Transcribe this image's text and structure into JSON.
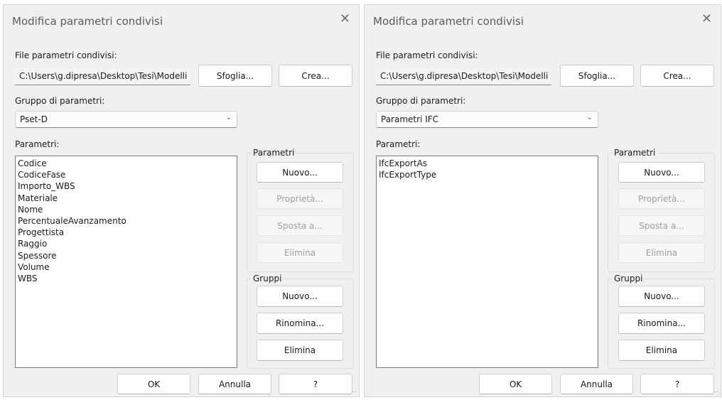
{
  "dialogs": [
    {
      "title": "Modifica parametri condivisi",
      "close_glyph": "✕",
      "file_label": "File parametri condivisi:",
      "file_path": "C:\\Users\\g.dipresa\\Desktop\\Tesi\\Modelli",
      "browse_label": "Sfoglia...",
      "create_label": "Crea...",
      "group_label": "Gruppo di parametri:",
      "group_selected": "Pset-D",
      "params_label": "Parametri:",
      "params": [
        "Codice",
        "CodiceFase",
        "Importo_WBS",
        "Materiale",
        "Nome",
        "PercentualeAvanzamento",
        "Progettista",
        "Raggio",
        "Spessore",
        "Volume",
        "WBS"
      ],
      "param_box_title": "Parametri",
      "param_new": "Nuovo...",
      "param_props": "Proprietà...",
      "param_move": "Sposta a...",
      "param_delete": "Elimina",
      "groups_box_title": "Gruppi",
      "group_new": "Nuovo...",
      "group_rename": "Rinomina...",
      "group_delete": "Elimina",
      "ok": "OK",
      "cancel": "Annulla",
      "help": "?"
    },
    {
      "title": "Modifica parametri condivisi",
      "close_glyph": "✕",
      "file_label": "File parametri condivisi:",
      "file_path": "C:\\Users\\g.dipresa\\Desktop\\Tesi\\Modelli",
      "browse_label": "Sfoglia...",
      "create_label": "Crea...",
      "group_label": "Gruppo di parametri:",
      "group_selected": "Parametri IFC",
      "params_label": "Parametri:",
      "params": [
        "IfcExportAs",
        "IfcExportType"
      ],
      "param_box_title": "Parametri",
      "param_new": "Nuovo...",
      "param_props": "Proprietà...",
      "param_move": "Sposta a...",
      "param_delete": "Elimina",
      "groups_box_title": "Gruppi",
      "group_new": "Nuovo...",
      "group_rename": "Rinomina...",
      "group_delete": "Elimina",
      "ok": "OK",
      "cancel": "Annulla",
      "help": "?"
    }
  ]
}
